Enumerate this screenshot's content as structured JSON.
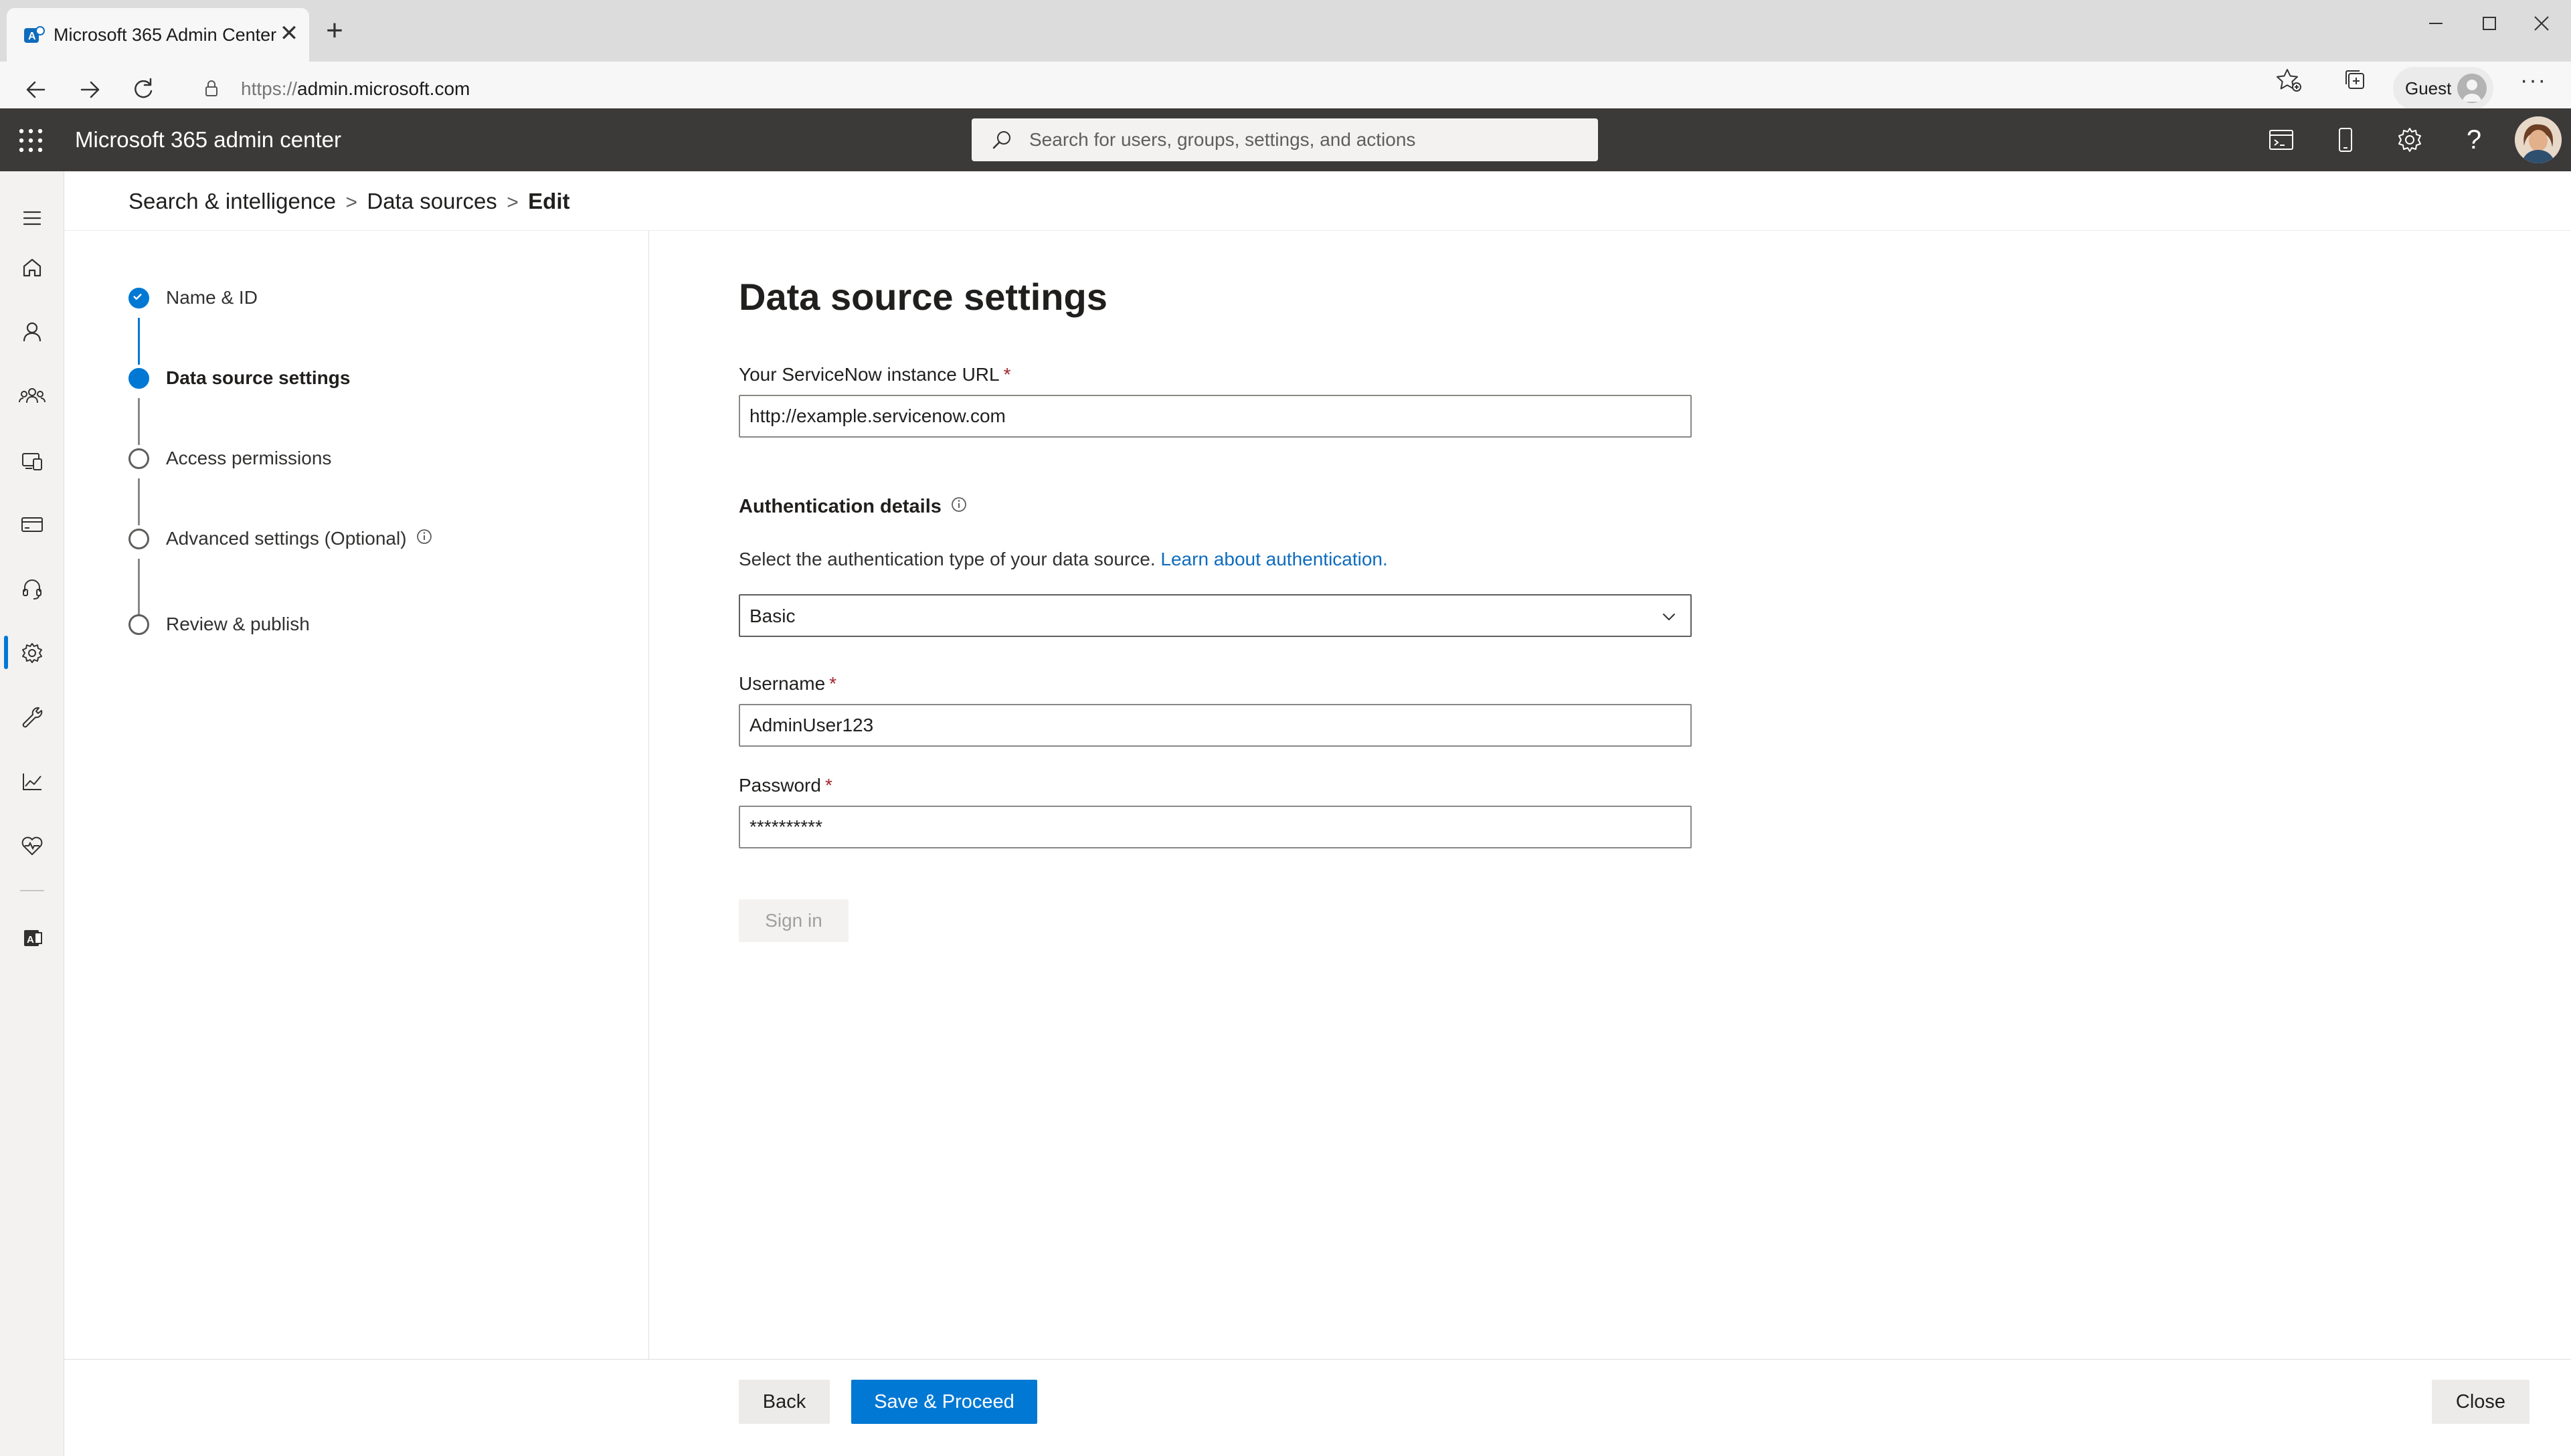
{
  "browser": {
    "tab_title": "Microsoft 365 Admin Center",
    "tab_close_glyph": "✕",
    "new_tab_glyph": "+",
    "url_protocol": "https://",
    "url_host": "admin.microsoft.com",
    "profile_label": "Guest",
    "more_glyph": "···"
  },
  "header": {
    "app_title": "Microsoft 365 admin center",
    "search_placeholder": "Search for users, groups, settings, and actions",
    "help_glyph": "?"
  },
  "rail": {
    "items": [
      "menu",
      "home",
      "users",
      "teams-groups",
      "devices",
      "billing",
      "support",
      "settings",
      "setup",
      "reports",
      "health",
      "exchange"
    ],
    "active": "settings"
  },
  "breadcrumb": {
    "items": [
      "Search & intelligence",
      "Data sources"
    ],
    "separator": ">",
    "current": "Edit"
  },
  "steps": [
    {
      "label": "Name & ID",
      "state": "done"
    },
    {
      "label": "Data source settings",
      "state": "current"
    },
    {
      "label": "Access permissions",
      "state": "pending"
    },
    {
      "label": "Advanced settings (Optional)",
      "state": "pending"
    },
    {
      "label": "Review & publish",
      "state": "pending"
    }
  ],
  "form": {
    "title": "Data source settings",
    "url_label": "Your ServiceNow instance URL",
    "url_value": "http://example.servicenow.com",
    "required_mark": "*",
    "auth_section": "Authentication details",
    "auth_helper": "Select the authentication type of your data source.",
    "auth_link": "Learn about authentication.",
    "auth_type": "Basic",
    "username_label": "Username",
    "username_value": "AdminUser123",
    "password_label": "Password",
    "password_value": "**********",
    "signin_label": "Sign in"
  },
  "footer": {
    "back_label": "Back",
    "save_label": "Save & Proceed",
    "close_label": "Close"
  },
  "colors": {
    "accent": "#0078d4",
    "header_bg": "#3b3a39",
    "required": "#a4262c",
    "link": "#0f6cbd"
  }
}
